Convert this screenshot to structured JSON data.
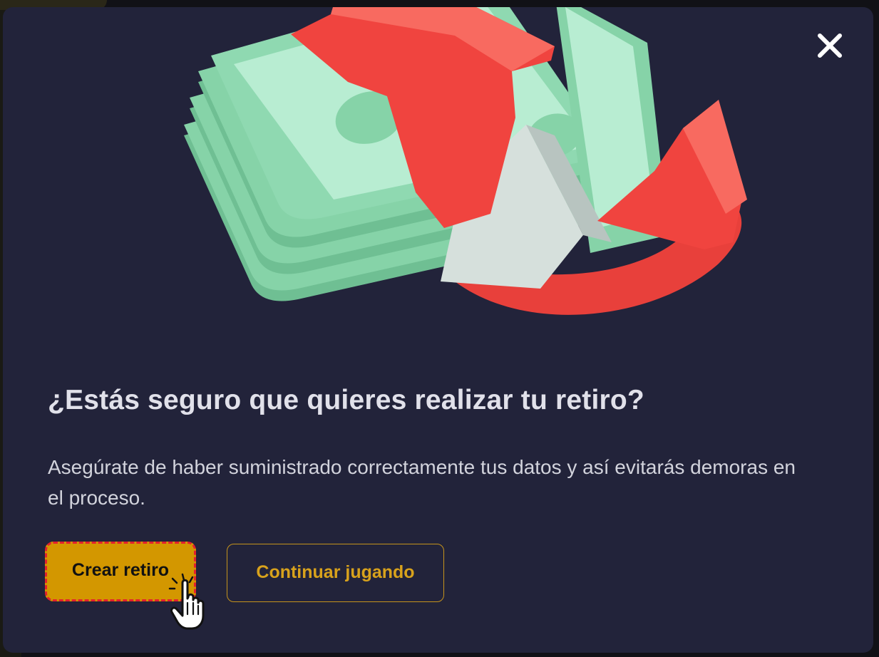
{
  "dialog": {
    "title": "¿Estás seguro que quieres realizar tu retiro?",
    "description": "Asegúrate de haber suministrado correctamente tus datos y así evitarás demoras en el proceso.",
    "primary_button": "Crear retiro",
    "secondary_button": "Continuar jugando",
    "close_icon": "close-icon",
    "illustration": "money-withdrawal-illustration"
  },
  "colors": {
    "modal_background": "#22233a",
    "primary_button": "#d39700",
    "secondary_button_border": "#c5931c",
    "secondary_button_text": "#d8a21c",
    "highlight_border": "#e4212d",
    "money_green": "#7ccaa0",
    "arrow_red": "#f0443f"
  }
}
